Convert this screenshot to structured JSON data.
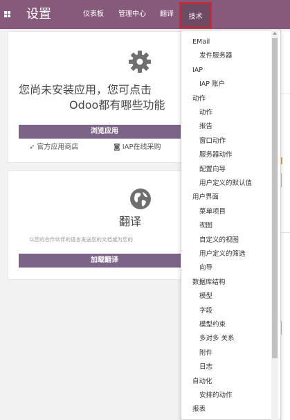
{
  "topbar": {
    "title": "设置",
    "nav": [
      "仪表板",
      "管理中心",
      "翻译",
      "技术"
    ]
  },
  "apps_card": {
    "heading_line1": "您尚未安装应用，您可点击",
    "heading_line2": "Odoo都有哪些功能",
    "browse_button": "浏览应用",
    "store_link": "官方应用商店",
    "iap_link": "IAP在线采购"
  },
  "translate_card": {
    "title": "翻译",
    "subtitle": "以您的合作伙伴的语言发送您的文档或为您的",
    "load_button": "加载翻译"
  },
  "menu": [
    {
      "type": "header",
      "label": "EMail"
    },
    {
      "type": "item",
      "label": "发件服务器"
    },
    {
      "type": "header",
      "label": "IAP"
    },
    {
      "type": "item",
      "label": "IAP 账户"
    },
    {
      "type": "header",
      "label": "动作"
    },
    {
      "type": "item",
      "label": "动作"
    },
    {
      "type": "item",
      "label": "报告"
    },
    {
      "type": "item",
      "label": "窗口动作"
    },
    {
      "type": "item",
      "label": "服务器动作"
    },
    {
      "type": "item",
      "label": "配置向导"
    },
    {
      "type": "item",
      "label": "用户定义的默认值"
    },
    {
      "type": "header",
      "label": "用户界面"
    },
    {
      "type": "item",
      "label": "菜单项目"
    },
    {
      "type": "item",
      "label": "视图"
    },
    {
      "type": "item",
      "label": "自定义的视图"
    },
    {
      "type": "item",
      "label": "用户定义的筛选"
    },
    {
      "type": "item",
      "label": "向导"
    },
    {
      "type": "header",
      "label": "数据库结构"
    },
    {
      "type": "item",
      "label": "模型"
    },
    {
      "type": "item",
      "label": "字段"
    },
    {
      "type": "item",
      "label": "模型约束"
    },
    {
      "type": "item",
      "label": "多对多 关系"
    },
    {
      "type": "item",
      "label": "附件"
    },
    {
      "type": "item",
      "label": "日志"
    },
    {
      "type": "header",
      "label": "自动化"
    },
    {
      "type": "item",
      "label": "安排的动作"
    },
    {
      "type": "header",
      "label": "报表"
    }
  ],
  "colors": {
    "brand": "#875a7b",
    "button": "#7c6488",
    "highlight": "#d9222a"
  }
}
